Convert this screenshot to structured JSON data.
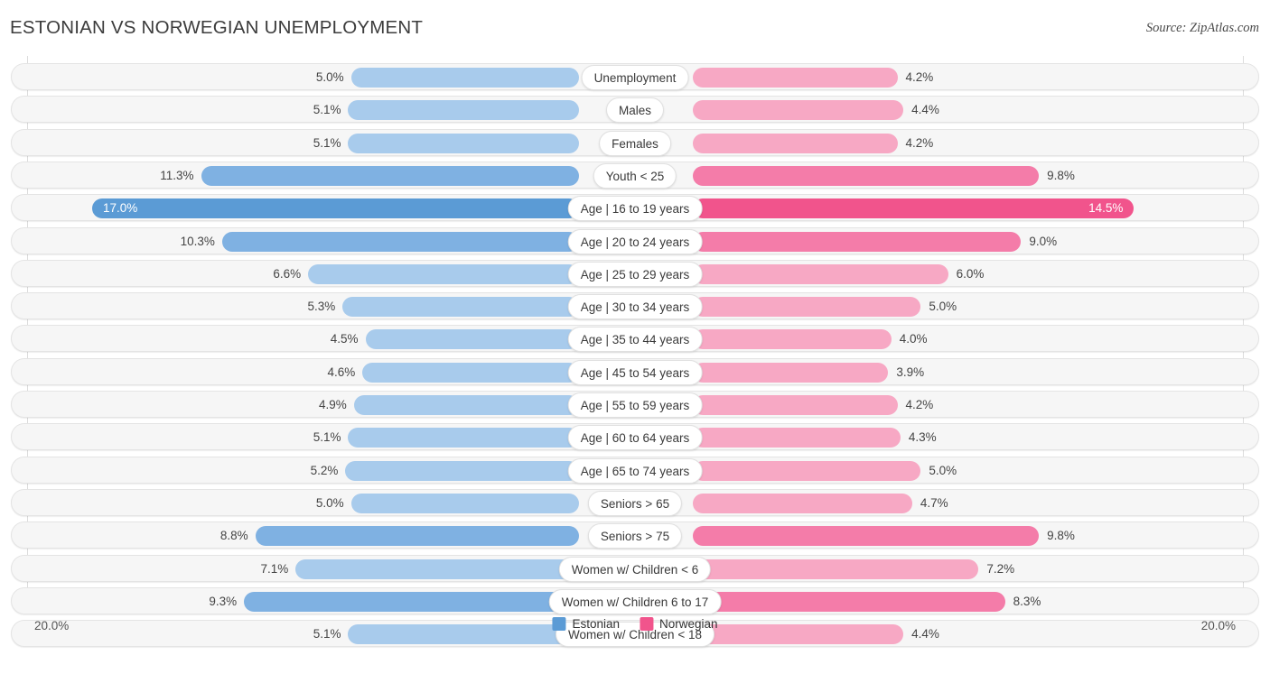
{
  "header": {
    "title": "ESTONIAN VS NORWEGIAN UNEMPLOYMENT",
    "source": "Source: ZipAtlas.com"
  },
  "axis": {
    "left_tick": "20.0%",
    "right_tick": "20.0%"
  },
  "legend": {
    "items": [
      {
        "label": "Estonian",
        "color": "#5b9bd5"
      },
      {
        "label": "Norwegian",
        "color": "#f1548c"
      }
    ]
  },
  "colors": {
    "left_light": "#a8cbec",
    "left_mid": "#7fb1e2",
    "left_strong": "#5b9bd5",
    "right_light": "#f7a8c4",
    "right_mid": "#f47ca9",
    "right_strong": "#f1548c",
    "track": "#f6f6f6",
    "track_border": "#e4e4e4"
  },
  "chart_data": {
    "type": "bar",
    "orientation": "diverging-horizontal",
    "title": "ESTONIAN VS NORWEGIAN UNEMPLOYMENT",
    "xlabel": "",
    "ylabel": "",
    "axis_max": 20.0,
    "unit": "%",
    "grid": false,
    "legend_position": "bottom-center",
    "categories": [
      "Unemployment",
      "Males",
      "Females",
      "Youth < 25",
      "Age | 16 to 19 years",
      "Age | 20 to 24 years",
      "Age | 25 to 29 years",
      "Age | 30 to 34 years",
      "Age | 35 to 44 years",
      "Age | 45 to 54 years",
      "Age | 55 to 59 years",
      "Age | 60 to 64 years",
      "Age | 65 to 74 years",
      "Seniors > 65",
      "Seniors > 75",
      "Women w/ Children < 6",
      "Women w/ Children 6 to 17",
      "Women w/ Children < 18"
    ],
    "series": [
      {
        "name": "Estonian",
        "side": "left",
        "color": "#5b9bd5",
        "values": [
          5.0,
          5.1,
          5.1,
          11.3,
          17.0,
          10.3,
          6.6,
          5.3,
          4.5,
          4.6,
          4.9,
          5.1,
          5.2,
          5.0,
          8.8,
          7.1,
          9.3,
          5.1
        ],
        "labels": [
          "5.0%",
          "5.1%",
          "5.1%",
          "11.3%",
          "17.0%",
          "10.3%",
          "6.6%",
          "5.3%",
          "4.5%",
          "4.6%",
          "4.9%",
          "5.1%",
          "5.2%",
          "5.0%",
          "8.8%",
          "7.1%",
          "9.3%",
          "5.1%"
        ]
      },
      {
        "name": "Norwegian",
        "side": "right",
        "color": "#f1548c",
        "values": [
          4.2,
          4.4,
          4.2,
          9.8,
          14.5,
          9.0,
          6.0,
          5.0,
          4.0,
          3.9,
          4.2,
          4.3,
          5.0,
          4.7,
          9.8,
          7.2,
          8.3,
          4.4
        ],
        "labels": [
          "4.2%",
          "4.4%",
          "4.2%",
          "9.8%",
          "14.5%",
          "9.0%",
          "6.0%",
          "5.0%",
          "4.0%",
          "3.9%",
          "4.2%",
          "4.3%",
          "5.0%",
          "4.7%",
          "9.8%",
          "7.2%",
          "8.3%",
          "4.4%"
        ]
      }
    ]
  }
}
